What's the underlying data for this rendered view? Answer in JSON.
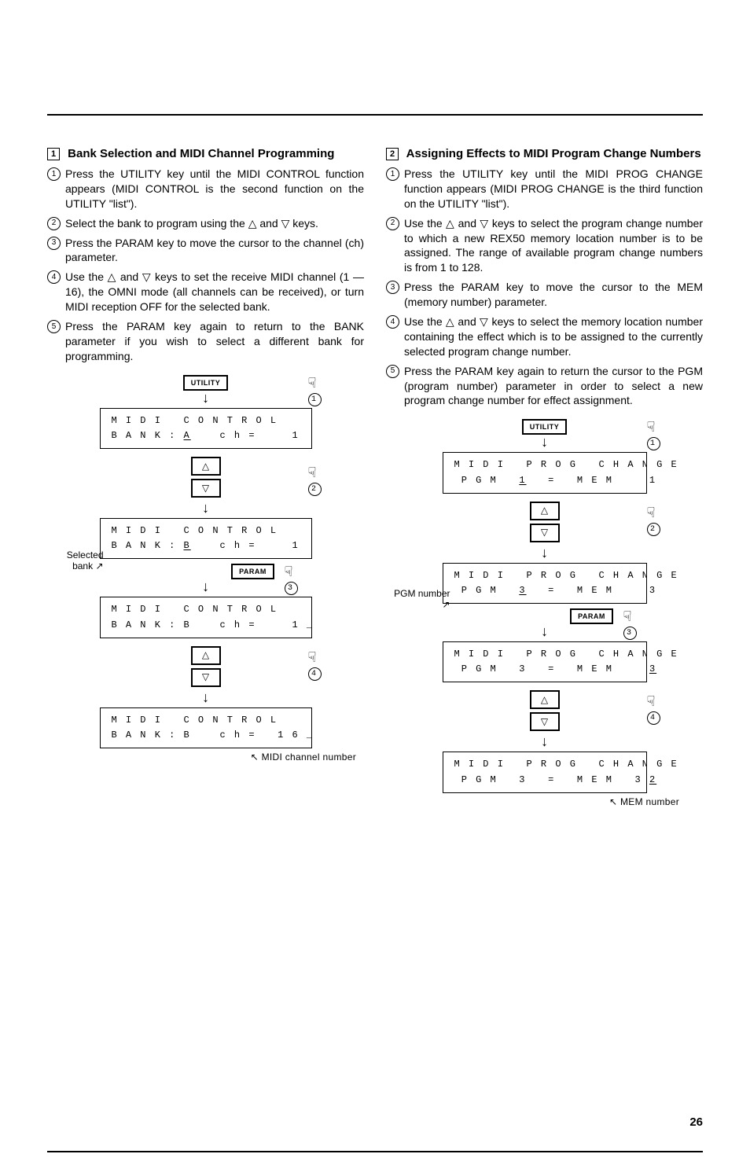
{
  "page_number": "26",
  "left": {
    "boxnum": "1",
    "title": "Bank Selection and MIDI Channel Programming",
    "steps": [
      "Press the UTILITY key until the MIDI CONTROL function appears (MIDI CONTROL is the second function on the UTILITY \"list\").",
      "Select the bank to program using the △ and ▽ keys.",
      "Press the PARAM key to move the cursor to the channel (ch) parameter.",
      "Use the △ and ▽ keys to set the receive MIDI channel (1 — 16), the OMNI mode (all channels can be received), or turn MIDI reception OFF for the selected bank.",
      "Press the PARAM key again to return to the BANK parameter if you wish to select a different bank for programming."
    ],
    "flow": {
      "utility": "UTILITY",
      "param": "PARAM",
      "lcd1_l1": "M I D I   C O N T R O L",
      "lcd1_l2_a": "B A N K : ",
      "lcd1_l2_b": "A",
      "lcd1_l2_c": "    c h =     1",
      "lcd2_l2_a": "B A N K : ",
      "lcd2_l2_b": "B",
      "lcd2_l2_c": "    c h =     1",
      "lcd3_l2": "B A N K : B    c h =     1 _",
      "lcd4_l2": "B A N K : B    c h =   1 6 _",
      "selected_bank": "Selected bank",
      "midi_ch_label": "MIDI channel number"
    }
  },
  "right": {
    "boxnum": "2",
    "title": "Assigning Effects to MIDI Program Change Numbers",
    "steps": [
      "Press the UTILITY key until the MIDI PROG CHANGE function appears (MIDI PROG CHANGE is the third function on the UTILITY \"list\").",
      "Use the △ and ▽ keys to select the program change number to which a new REX50 memory location number is to be assigned. The range of available program change numbers is from 1 to 128.",
      "Press the PARAM key to move the cursor to the MEM (memory number) parameter.",
      "Use the △ and ▽ keys to select the memory location number containing the effect which is to be assigned to the currently selected program change number.",
      "Press the PARAM key again to return the cursor to the PGM (program number) parameter in order to select a new program change number for effect assignment."
    ],
    "flow": {
      "utility": "UTILITY",
      "param": "PARAM",
      "lcd_title": "M I D I   P R O G   C H A N G E",
      "lcd1_l2_a": " P G M   ",
      "lcd1_l2_b": "1",
      "lcd1_l2_c": "   =   M E M     1",
      "lcd2_l2_a": " P G M   ",
      "lcd2_l2_b": "3",
      "lcd2_l2_c": "   =   M E M     3",
      "lcd3_l2_a": " P G M   3   =   M E M     ",
      "lcd3_l2_b": "3",
      "lcd4_l2_a": " P G M   3   =   M E M   3 ",
      "lcd4_l2_b": "2",
      "pgm_label": "PGM number",
      "mem_label": "MEM number"
    }
  }
}
